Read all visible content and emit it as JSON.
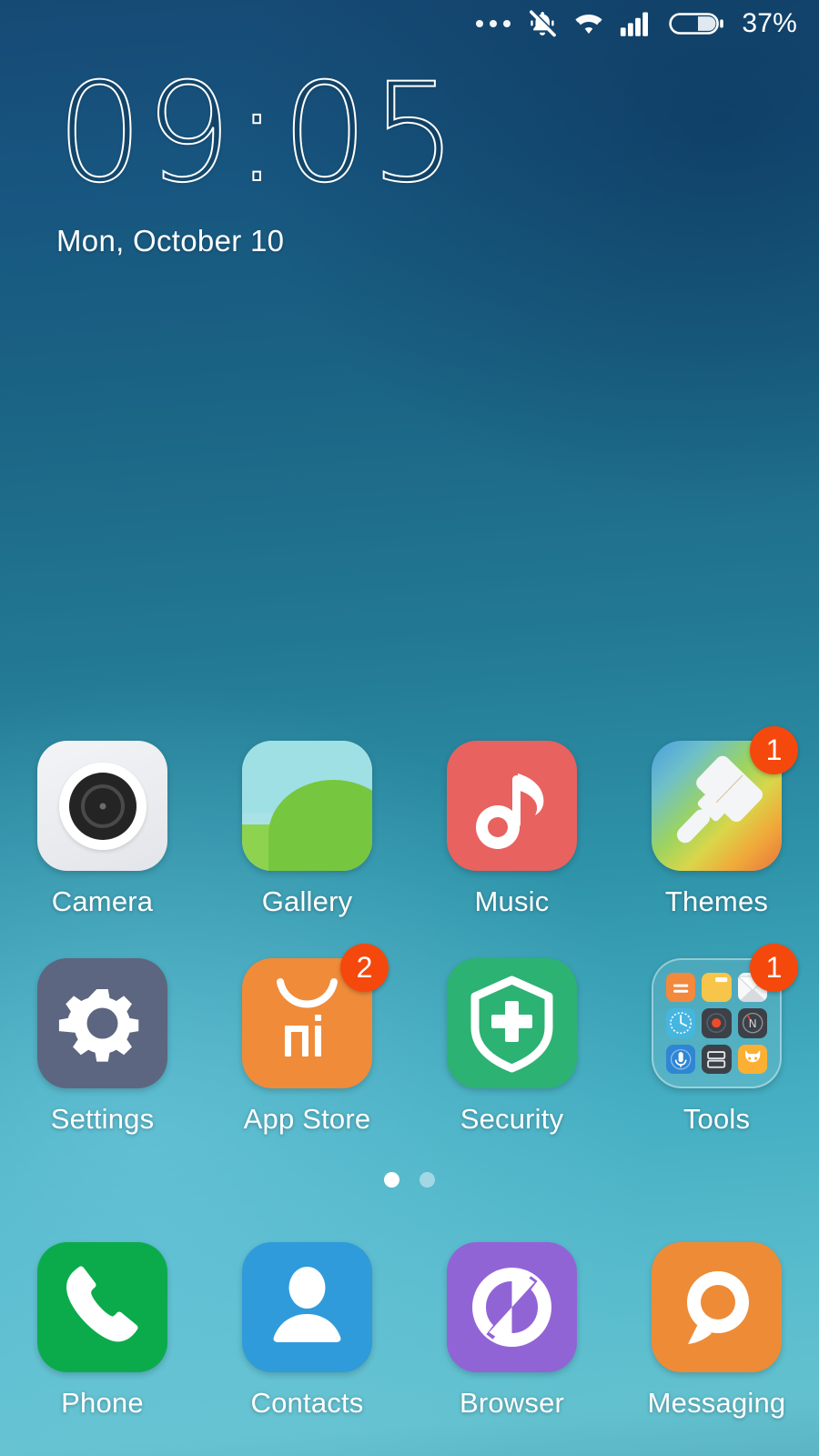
{
  "status_bar": {
    "notification_dots_icon": "more-dots-icon",
    "ringer_icon": "vibrate-silent-bell-icon",
    "wifi_icon": "wifi-icon",
    "signal_icon": "cellular-signal-icon",
    "battery_icon": "battery-icon",
    "battery_percent": "37%"
  },
  "clock_widget": {
    "hours": "09",
    "separator": ":",
    "minutes": "05",
    "time": "09:05",
    "date": "Mon, October 10"
  },
  "home_grid": {
    "rows": [
      [
        {
          "label": "Camera",
          "icon": "camera-icon",
          "badge": null
        },
        {
          "label": "Gallery",
          "icon": "gallery-icon",
          "badge": null
        },
        {
          "label": "Music",
          "icon": "music-icon",
          "badge": null
        },
        {
          "label": "Themes",
          "icon": "themes-icon",
          "badge": "1"
        }
      ],
      [
        {
          "label": "Settings",
          "icon": "settings-icon",
          "badge": null
        },
        {
          "label": "App Store",
          "icon": "app-store-icon",
          "badge": "2"
        },
        {
          "label": "Security",
          "icon": "security-icon",
          "badge": null
        },
        {
          "label": "Tools",
          "icon": "tools-folder-icon",
          "badge": "1"
        }
      ]
    ]
  },
  "tools_folder": {
    "mini_apps": [
      {
        "name": "calculator-icon",
        "color": "#f2893c"
      },
      {
        "name": "notes-icon",
        "color": "#f7c54a"
      },
      {
        "name": "mail-icon",
        "color": "#f1f2f4"
      },
      {
        "name": "clock-icon",
        "color": "#45b6e0"
      },
      {
        "name": "recorder-icon",
        "color": "#3c4148"
      },
      {
        "name": "compass-icon",
        "color": "#3c4148"
      },
      {
        "name": "voice-memo-icon",
        "color": "#2f86d4"
      },
      {
        "name": "screenshot-icon",
        "color": "#3c4148"
      },
      {
        "name": "mi-mover-icon",
        "color": "#fbb034"
      }
    ]
  },
  "page_indicator": {
    "pages": 2,
    "active_page": 1
  },
  "dock": {
    "items": [
      {
        "label": "Phone",
        "icon": "phone-icon"
      },
      {
        "label": "Contacts",
        "icon": "contacts-icon"
      },
      {
        "label": "Browser",
        "icon": "browser-icon"
      },
      {
        "label": "Messaging",
        "icon": "messaging-icon"
      }
    ]
  },
  "colors": {
    "badge": "#f5480c",
    "music": "#e8625f",
    "settings": "#5c6680",
    "app_store": "#f08b3a",
    "security": "#2cb272",
    "phone": "#0bab4c",
    "contacts": "#2f9bda",
    "browser": "#9164d6",
    "messaging": "#ee8b36",
    "wallpaper_top": "#164a75",
    "wallpaper_bottom": "#63c1cf"
  }
}
